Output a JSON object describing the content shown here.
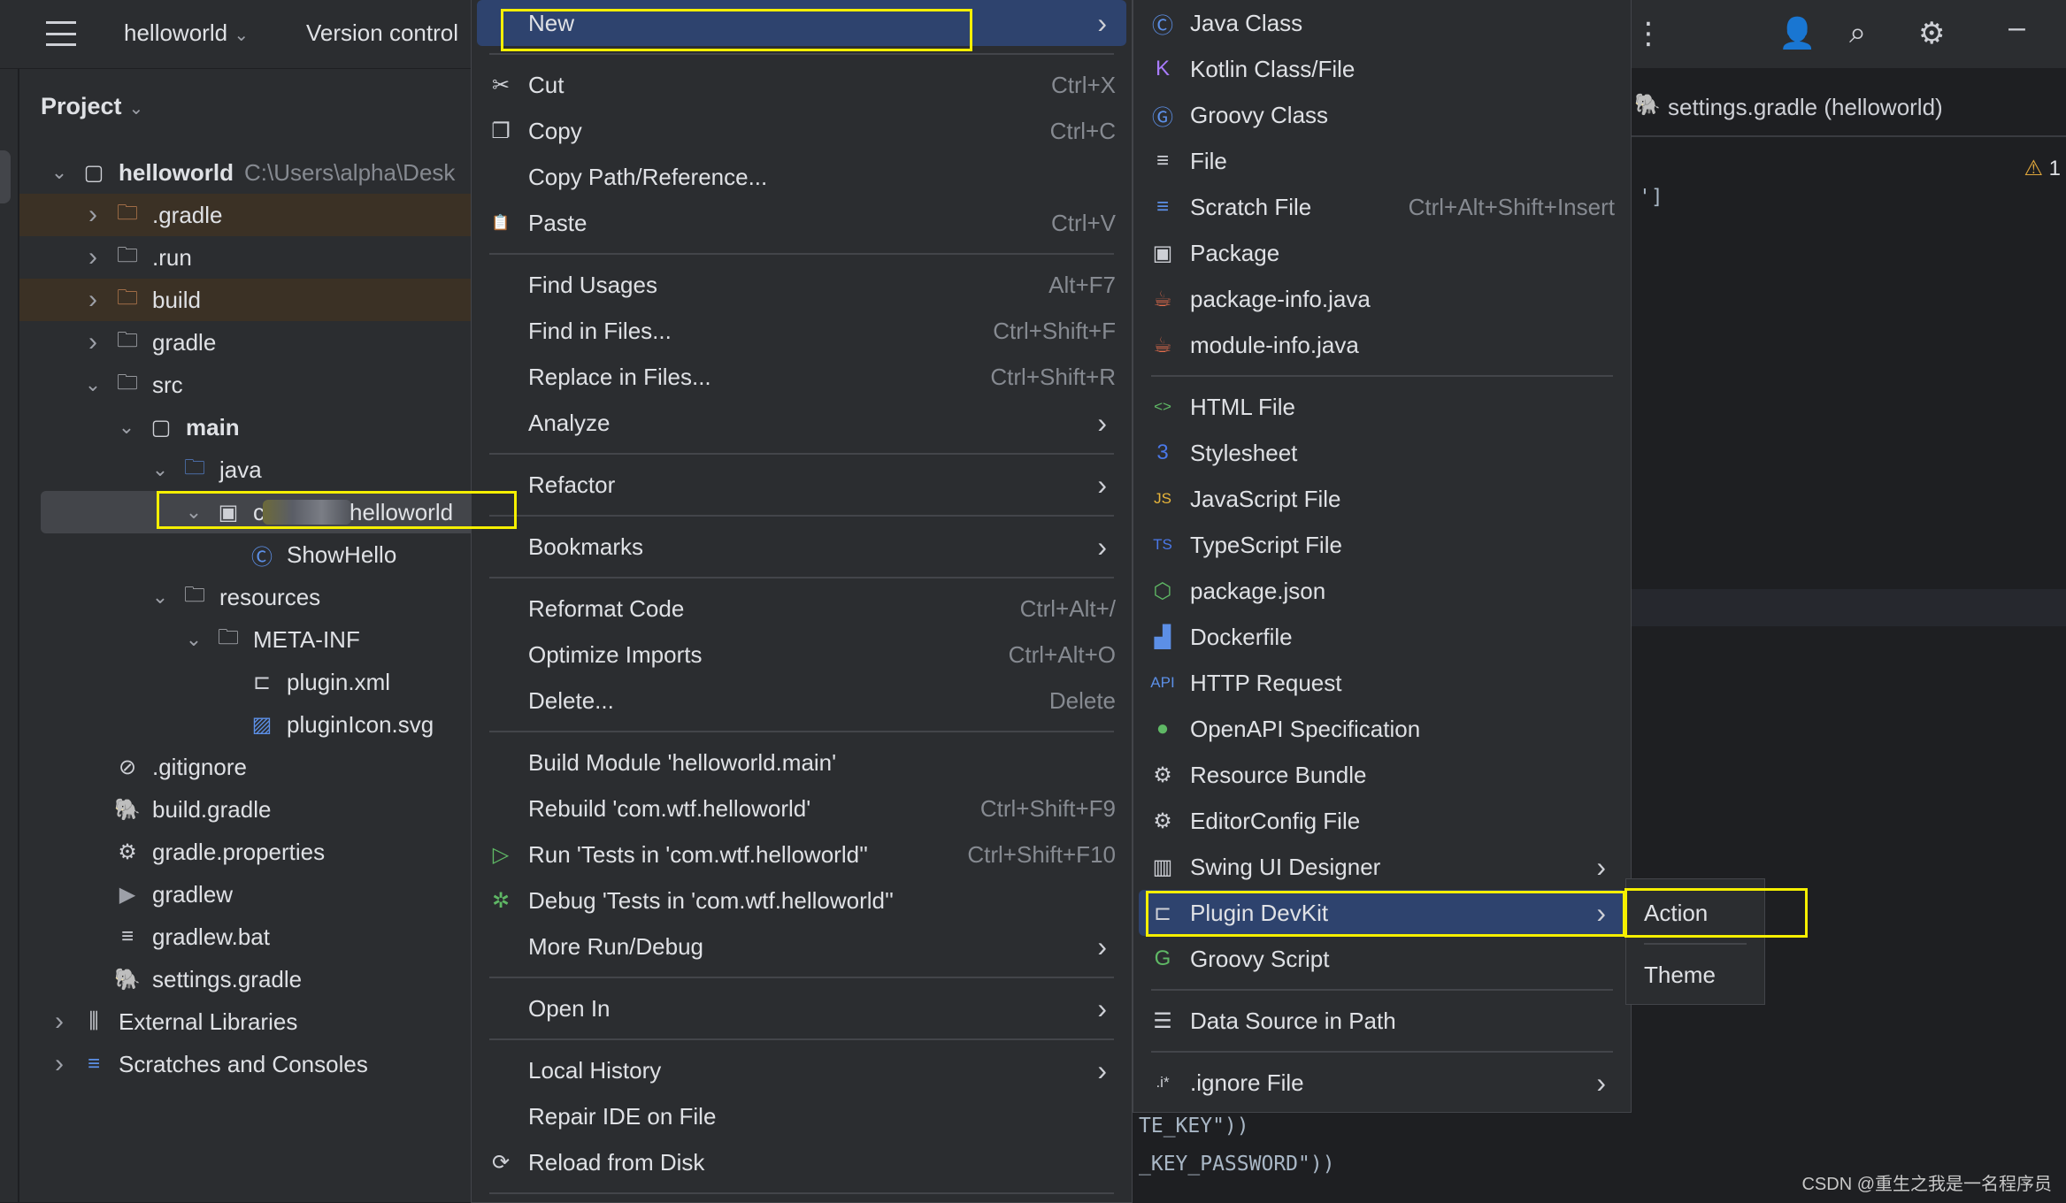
{
  "titlebar": {
    "project": "helloworld",
    "vcs": "Version control",
    "icons": [
      "more-icon",
      "add-user-icon",
      "search-icon",
      "settings-icon",
      "minimize-icon"
    ]
  },
  "project_panel": {
    "title": "Project",
    "tree": [
      {
        "label": "helloworld",
        "path": "C:\\Users\\alpha\\Desk",
        "level": 0,
        "arrow": "down",
        "icon": "module",
        "bold": true
      },
      {
        "label": ".gradle",
        "level": 1,
        "arrow": "right",
        "icon": "folder-orange",
        "style": "orange"
      },
      {
        "label": ".run",
        "level": 1,
        "arrow": "right",
        "icon": "folder"
      },
      {
        "label": "build",
        "level": 1,
        "arrow": "right",
        "icon": "folder-orange",
        "style": "orange"
      },
      {
        "label": "gradle",
        "level": 1,
        "arrow": "right",
        "icon": "folder"
      },
      {
        "label": "src",
        "level": 1,
        "arrow": "down",
        "icon": "folder"
      },
      {
        "label": "main",
        "level": 2,
        "arrow": "down",
        "icon": "module",
        "bold": true
      },
      {
        "label": "java",
        "level": 3,
        "arrow": "down",
        "icon": "folder-blue"
      },
      {
        "label": "helloworld",
        "prefix": "c",
        "level": 4,
        "arrow": "down",
        "icon": "package",
        "style": "selected",
        "blurred": true
      },
      {
        "label": "ShowHello",
        "level": 5,
        "icon": "class"
      },
      {
        "label": "resources",
        "level": 3,
        "arrow": "down",
        "icon": "resources"
      },
      {
        "label": "META-INF",
        "level": 4,
        "arrow": "down",
        "icon": "folder"
      },
      {
        "label": "plugin.xml",
        "level": 5,
        "icon": "plugin"
      },
      {
        "label": "pluginIcon.svg",
        "level": 5,
        "icon": "image"
      },
      {
        "label": ".gitignore",
        "level": 1,
        "icon": "ignore"
      },
      {
        "label": "build.gradle",
        "level": 1,
        "icon": "gradle"
      },
      {
        "label": "gradle.properties",
        "level": 1,
        "icon": "gear"
      },
      {
        "label": "gradlew",
        "level": 1,
        "icon": "terminal"
      },
      {
        "label": "gradlew.bat",
        "level": 1,
        "icon": "lines"
      },
      {
        "label": "settings.gradle",
        "level": 1,
        "icon": "gradle"
      },
      {
        "label": "External Libraries",
        "level": 0,
        "arrow": "right",
        "icon": "library"
      },
      {
        "label": "Scratches and Consoles",
        "level": 0,
        "arrow": "right",
        "icon": "scratch"
      }
    ]
  },
  "context_menu": [
    {
      "label": "New",
      "submenu": true,
      "highlighted": true
    },
    {
      "sep": true
    },
    {
      "label": "Cut",
      "shortcut": "Ctrl+X",
      "icon": "cut"
    },
    {
      "label": "Copy",
      "shortcut": "Ctrl+C",
      "icon": "copy"
    },
    {
      "label": "Copy Path/Reference..."
    },
    {
      "label": "Paste",
      "shortcut": "Ctrl+V",
      "icon": "paste"
    },
    {
      "sep": true
    },
    {
      "label": "Find Usages",
      "shortcut": "Alt+F7"
    },
    {
      "label": "Find in Files...",
      "shortcut": "Ctrl+Shift+F"
    },
    {
      "label": "Replace in Files...",
      "shortcut": "Ctrl+Shift+R"
    },
    {
      "label": "Analyze",
      "submenu": true
    },
    {
      "sep": true
    },
    {
      "label": "Refactor",
      "submenu": true
    },
    {
      "sep": true
    },
    {
      "label": "Bookmarks",
      "submenu": true
    },
    {
      "sep": true
    },
    {
      "label": "Reformat Code",
      "shortcut": "Ctrl+Alt+/"
    },
    {
      "label": "Optimize Imports",
      "shortcut": "Ctrl+Alt+O"
    },
    {
      "label": "Delete...",
      "shortcut": "Delete"
    },
    {
      "sep": true
    },
    {
      "label": "Build Module 'helloworld.main'"
    },
    {
      "label": "Rebuild 'com.wtf.helloworld'",
      "shortcut": "Ctrl+Shift+F9"
    },
    {
      "label": "Run 'Tests in 'com.wtf.helloworld''",
      "shortcut": "Ctrl+Shift+F10",
      "icon": "run"
    },
    {
      "label": "Debug 'Tests in 'com.wtf.helloworld''",
      "icon": "debug"
    },
    {
      "label": "More Run/Debug",
      "submenu": true
    },
    {
      "sep": true
    },
    {
      "label": "Open In",
      "submenu": true
    },
    {
      "sep": true
    },
    {
      "label": "Local History",
      "submenu": true
    },
    {
      "label": "Repair IDE on File"
    },
    {
      "label": "Reload from Disk",
      "icon": "reload"
    },
    {
      "sep": true
    }
  ],
  "new_submenu": [
    {
      "label": "Java Class",
      "icon": "class"
    },
    {
      "label": "Kotlin Class/File",
      "icon": "kotlin"
    },
    {
      "label": "Groovy Class",
      "icon": "groovy-class"
    },
    {
      "label": "File",
      "icon": "lines"
    },
    {
      "label": "Scratch File",
      "shortcut": "Ctrl+Alt+Shift+Insert",
      "icon": "scratch"
    },
    {
      "label": "Package",
      "icon": "package"
    },
    {
      "label": "package-info.java",
      "icon": "java-cup"
    },
    {
      "label": "module-info.java",
      "icon": "java-cup"
    },
    {
      "sep": true
    },
    {
      "label": "HTML File",
      "icon": "html"
    },
    {
      "label": "Stylesheet",
      "icon": "css"
    },
    {
      "label": "JavaScript File",
      "icon": "js"
    },
    {
      "label": "TypeScript File",
      "icon": "ts"
    },
    {
      "label": "package.json",
      "icon": "node"
    },
    {
      "label": "Dockerfile",
      "icon": "docker"
    },
    {
      "label": "HTTP Request",
      "icon": "api"
    },
    {
      "label": "OpenAPI Specification",
      "icon": "openapi"
    },
    {
      "label": "Resource Bundle",
      "icon": "gear"
    },
    {
      "label": "EditorConfig File",
      "icon": "gear"
    },
    {
      "label": "Swing UI Designer",
      "icon": "swing",
      "submenu": true
    },
    {
      "label": "Plugin DevKit",
      "icon": "plugin",
      "submenu": true,
      "highlighted": true
    },
    {
      "label": "Groovy Script",
      "icon": "groovy"
    },
    {
      "sep": true
    },
    {
      "label": "Data Source in Path",
      "icon": "db"
    },
    {
      "sep": true
    },
    {
      "label": ".ignore File",
      "icon": "ignore-file",
      "submenu": true
    }
  ],
  "plugin_submenu": [
    {
      "label": "Action"
    },
    {
      "sep": true
    },
    {
      "label": "Theme"
    }
  ],
  "editor": {
    "tab": "settings.gradle (helloworld)",
    "warnings": "1",
    "code": [
      "']",
      "TE_KEY\"))",
      "_KEY_PASSWORD\"))"
    ]
  },
  "watermark": "CSDN @重生之我是一名程序员",
  "colors": {
    "highlight": "#2e436e",
    "annotation": "#f5ef00",
    "panel": "#2b2d30",
    "editor": "#1e1f22"
  }
}
